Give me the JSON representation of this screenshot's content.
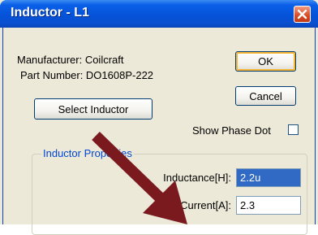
{
  "window": {
    "title": "Inductor - L1"
  },
  "info": {
    "manufacturer": "Manufacturer: Coilcraft",
    "part_number": "Part Number: DO1608P-222"
  },
  "buttons": {
    "ok": "OK",
    "cancel": "Cancel",
    "select_inductor": "Select Inductor"
  },
  "show_phase_dot": {
    "label": "Show Phase Dot",
    "checked": false
  },
  "group": {
    "label": "Inductor Properties",
    "inductance": {
      "label": "Inductance[H]:",
      "value": "2.2u"
    },
    "peak_current": {
      "label": "Peak Current[A]:",
      "value": "2.3"
    }
  },
  "colors": {
    "titlebar": "#0553d8",
    "group_label": "#0046d5",
    "arrow": "#7a1a1f",
    "selection": "#316ac5"
  }
}
